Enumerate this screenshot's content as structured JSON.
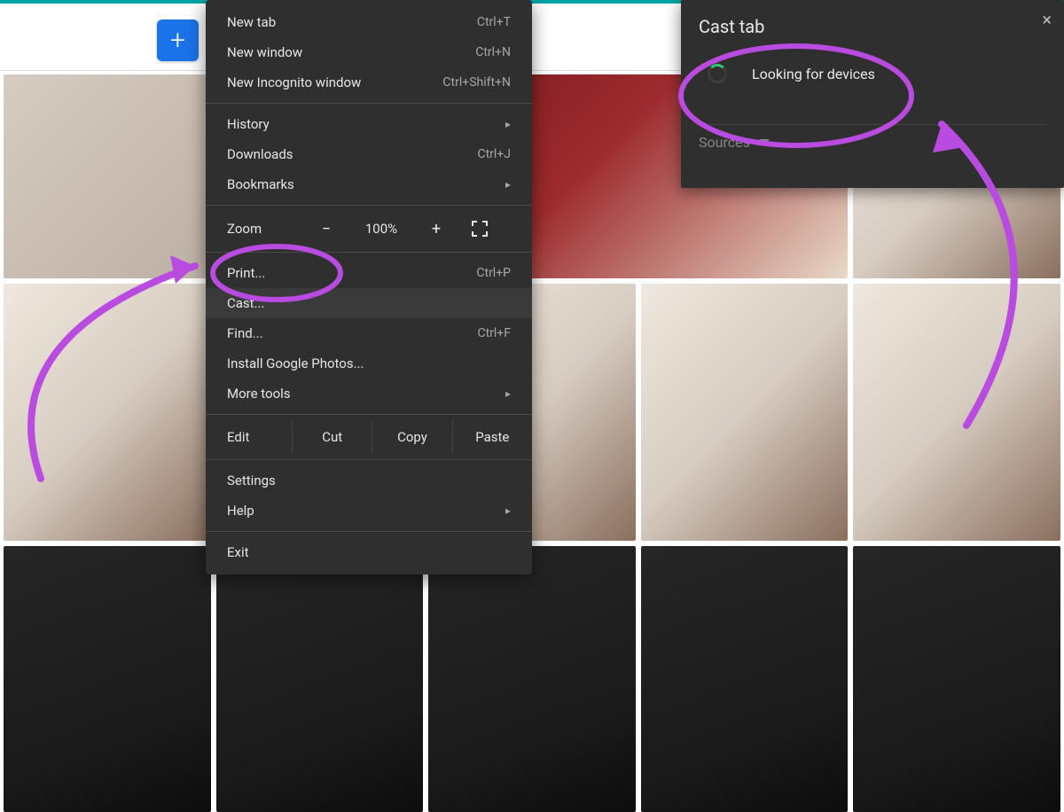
{
  "topbar": {
    "add_label": "+"
  },
  "context_menu": {
    "new_tab": {
      "label": "New tab",
      "shortcut": "Ctrl+T"
    },
    "new_window": {
      "label": "New window",
      "shortcut": "Ctrl+N"
    },
    "new_incognito": {
      "label": "New Incognito window",
      "shortcut": "Ctrl+Shift+N"
    },
    "history": {
      "label": "History"
    },
    "downloads": {
      "label": "Downloads",
      "shortcut": "Ctrl+J"
    },
    "bookmarks": {
      "label": "Bookmarks"
    },
    "zoom": {
      "label": "Zoom",
      "minus": "−",
      "value": "100%",
      "plus": "+"
    },
    "print": {
      "label": "Print...",
      "shortcut": "Ctrl+P"
    },
    "cast": {
      "label": "Cast..."
    },
    "find": {
      "label": "Find...",
      "shortcut": "Ctrl+F"
    },
    "install": {
      "label": "Install Google Photos..."
    },
    "more_tools": {
      "label": "More tools"
    },
    "edit": {
      "label": "Edit",
      "cut": "Cut",
      "copy": "Copy",
      "paste": "Paste"
    },
    "settings": {
      "label": "Settings"
    },
    "help": {
      "label": "Help"
    },
    "exit": {
      "label": "Exit"
    }
  },
  "cast_panel": {
    "title": "Cast tab",
    "status": "Looking for devices",
    "sources_label": "Sources",
    "close_glyph": "×"
  },
  "annotation": {
    "color": "#b94be0"
  }
}
